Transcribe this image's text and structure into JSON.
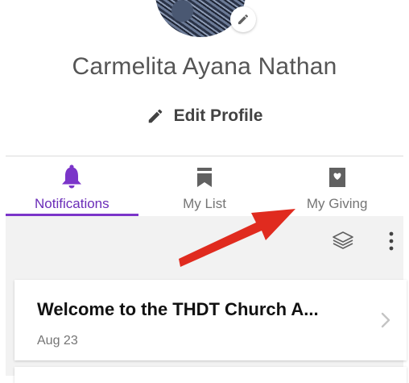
{
  "profile": {
    "name": "Carmelita Ayana Nathan",
    "edit_profile_label": "Edit Profile"
  },
  "tabs": [
    {
      "label": "Notifications",
      "icon": "bell-icon",
      "active": true
    },
    {
      "label": "My List",
      "icon": "bookmark-icon",
      "active": false
    },
    {
      "label": "My Giving",
      "icon": "heart-tag-icon",
      "active": false
    }
  ],
  "toolbar": {
    "icons": [
      "layers-icon",
      "more-vertical-icon"
    ]
  },
  "notifications": [
    {
      "title": "Welcome to the THDT Church A...",
      "date": "Aug 23"
    }
  ],
  "colors": {
    "accent": "#7b35c9",
    "annotation_arrow": "#e02b1f",
    "content_background": "#f2f2f2"
  }
}
